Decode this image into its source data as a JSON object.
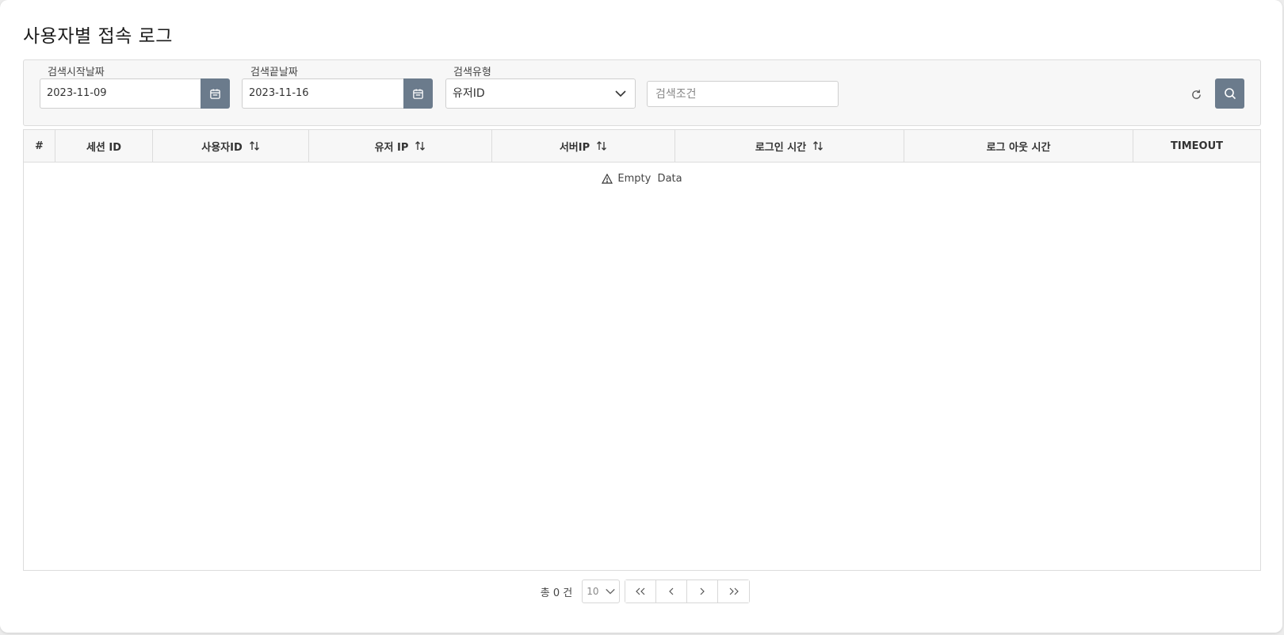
{
  "page": {
    "title": "사용자별 접속 로그"
  },
  "search": {
    "start_date_label": "검색시작날짜",
    "start_date_value": "2023-11-09",
    "end_date_label": "검색끝날짜",
    "end_date_value": "2023-11-16",
    "type_label": "검색유형",
    "type_value": "유저ID",
    "condition_placeholder": "검색조건"
  },
  "table": {
    "columns": [
      "#",
      "세션 ID",
      "사용자ID",
      "유저 IP",
      "서버IP",
      "로그인 시간",
      "로그 아웃 시간",
      "TIMEOUT"
    ],
    "empty_text": "Empty  Data"
  },
  "pagination": {
    "total_text": "총 0 건",
    "page_size": "10"
  },
  "colors": {
    "button_bg": "#6b7b8c",
    "header_bg": "#f7f7f7",
    "border": "#dcdcdc"
  },
  "icons": {
    "calendar": "calendar-icon",
    "chevron": "chevron-down-icon",
    "refresh": "refresh-icon",
    "search": "search-icon",
    "sort": "sort-icon",
    "warning": "warning-icon"
  }
}
